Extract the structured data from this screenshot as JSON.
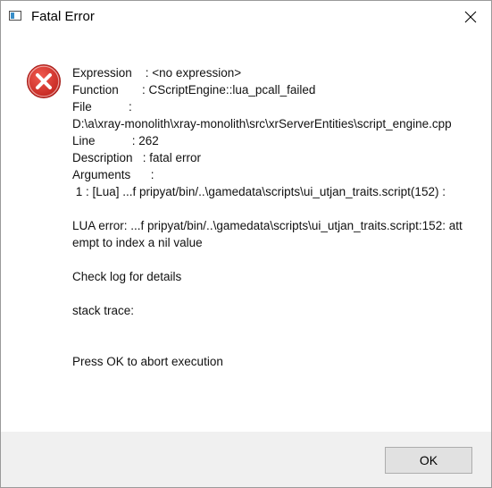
{
  "window": {
    "title": "Fatal Error",
    "app_icon": "window-icon",
    "close_icon": "close-icon"
  },
  "dialog": {
    "icon": "error-icon",
    "lines": {
      "expression": "Expression    : <no expression>",
      "function": "Function       : CScriptEngine::lua_pcall_failed",
      "file_label": "File           :",
      "file_path": "D:\\a\\xray-monolith\\xray-monolith\\src\\xrServerEntities\\script_engine.cpp",
      "line": "Line           : 262",
      "description": "Description   : fatal error",
      "arguments": "Arguments      :",
      "argument_1": " 1 : [Lua] ...f pripyat/bin/..\\gamedata\\scripts\\ui_utjan_traits.script(152) :",
      "lua_error": "LUA error: ...f pripyat/bin/..\\gamedata\\scripts\\ui_utjan_traits.script:152: attempt to index a nil value",
      "check_log": "Check log for details",
      "stack_trace": "stack trace:",
      "press_ok": "Press OK to abort execution"
    }
  },
  "buttons": {
    "ok_label": "OK"
  },
  "colors": {
    "error_red": "#d9332f",
    "footer_bg": "#f0f0f0",
    "button_bg": "#e1e1e1"
  }
}
